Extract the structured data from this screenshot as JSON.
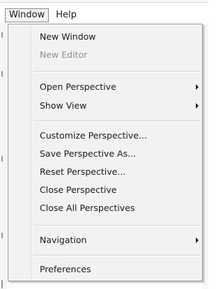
{
  "menubar": {
    "items": [
      {
        "label": "Window"
      },
      {
        "label": "Help"
      }
    ]
  },
  "window_menu": {
    "items": [
      {
        "label": "New Window",
        "enabled": true,
        "submenu": false
      },
      {
        "label": "New Editor",
        "enabled": false,
        "submenu": false
      },
      {
        "label": "Open Perspective",
        "enabled": true,
        "submenu": true
      },
      {
        "label": "Show View",
        "enabled": true,
        "submenu": true
      },
      {
        "label": "Customize Perspective...",
        "enabled": true,
        "submenu": false
      },
      {
        "label": "Save Perspective As...",
        "enabled": true,
        "submenu": false
      },
      {
        "label": "Reset Perspective...",
        "enabled": true,
        "submenu": false
      },
      {
        "label": "Close Perspective",
        "enabled": true,
        "submenu": false
      },
      {
        "label": "Close All Perspectives",
        "enabled": true,
        "submenu": false
      },
      {
        "label": "Navigation",
        "enabled": true,
        "submenu": true
      },
      {
        "label": "Preferences",
        "enabled": true,
        "submenu": false
      }
    ]
  },
  "colors": {
    "menu_background": "#f2f2f2",
    "menu_border": "#9a9a9a",
    "text": "#1a1a1a",
    "disabled_text": "#8f8f8f",
    "separator": "#d4d4d4"
  },
  "icons": {
    "submenu_arrow": "chevron-right-icon"
  }
}
